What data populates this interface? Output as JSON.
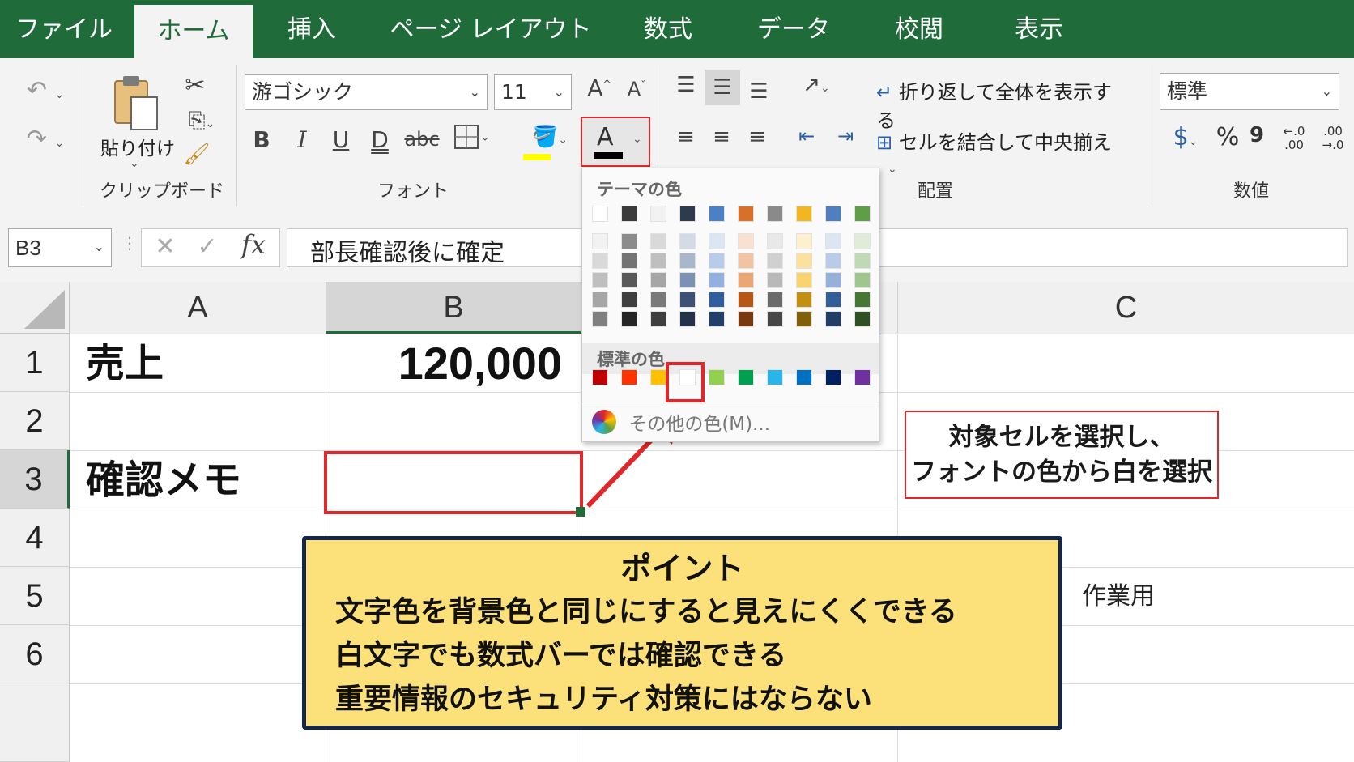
{
  "tabs": [
    "ファイル",
    "ホーム",
    "挿入",
    "ページ レイアウト",
    "数式",
    "データ",
    "校閲",
    "表示"
  ],
  "active_tab": "ホーム",
  "ribbon": {
    "clipboard": {
      "paste_label": "貼り付け",
      "group_label": "クリップボード"
    },
    "font": {
      "name": "游ゴシック",
      "size": "11",
      "group_label": "フォント",
      "bold": "B",
      "italic": "I",
      "underline": "U",
      "double_underline": "D",
      "strike": "abc",
      "grow": "A",
      "shrink": "A",
      "font_color_letter": "A"
    },
    "alignment": {
      "wrap_label": "折り返して全体を表示する",
      "merge_label": "セルを結合して中央揃え",
      "group_label": "配置"
    },
    "number": {
      "format": "標準",
      "group_label": "数値",
      "currency": "$",
      "percent": "%",
      "comma": "9",
      "inc_decimal": "←.0 .00",
      "dec_decimal": ".00 →.0"
    }
  },
  "formula_bar": {
    "name_box": "B3",
    "fx": "fx",
    "content": "部長確認後に確定"
  },
  "columns": [
    "A",
    "B",
    "C"
  ],
  "rows": [
    "1",
    "2",
    "3",
    "4",
    "5",
    "6"
  ],
  "cells": {
    "A1": "売上",
    "B1": "120,000",
    "A3": "確認メモ",
    "C5": "作業用"
  },
  "palette": {
    "theme_label": "テーマの色",
    "standard_label": "標準の色",
    "more_colors": "その他の色(M)...",
    "theme_top": [
      "#ffffff",
      "#3b3b3b",
      "#f2f2f2",
      "#2e3a4f",
      "#4b7fc6",
      "#d8702a",
      "#8a8a8a",
      "#f3b623",
      "#4f7fc0",
      "#5e9e47"
    ],
    "theme_shades": [
      [
        "#f2f2f2",
        "#d9d9d9",
        "#bfbfbf",
        "#a6a6a6",
        "#808080"
      ],
      [
        "#8c8c8c",
        "#737373",
        "#595959",
        "#404040",
        "#262626"
      ],
      [
        "#d9d9d9",
        "#bfbfbf",
        "#a6a6a6",
        "#7a7a7a",
        "#3f3f3f"
      ],
      [
        "#d4dbe6",
        "#a9b7cc",
        "#7d92b3",
        "#3d5276",
        "#24334b"
      ],
      [
        "#dbe5f4",
        "#b7cbea",
        "#93b1df",
        "#2f5f9f",
        "#203f6a"
      ],
      [
        "#f8e1d1",
        "#f1c3a3",
        "#eba676",
        "#b65617",
        "#793a0f"
      ],
      [
        "#e8e8e8",
        "#d0d0d0",
        "#b9b9b9",
        "#6b6b6b",
        "#474747"
      ],
      [
        "#fdf0cf",
        "#fbe19f",
        "#f9d36f",
        "#c28f10",
        "#81600b"
      ],
      [
        "#dce5f2",
        "#b9cbe6",
        "#96b1d9",
        "#325f99",
        "#213f66"
      ],
      [
        "#dfecd9",
        "#bfd9b4",
        "#9fc68e",
        "#467833",
        "#2f5022"
      ]
    ],
    "standard": [
      "#c00000",
      "#ff3300",
      "#ffc000",
      "#ffffff",
      "#92d050",
      "#00a050",
      "#29b5e8",
      "#0070c0",
      "#002060",
      "#7030a0"
    ]
  },
  "note": {
    "line1": "対象セルを選択し、",
    "line2": "フォントの色から白を選択"
  },
  "point": {
    "title": "ポイント",
    "line1": "文字色を背景色と同じにすると見えにくくできる",
    "line2": "白文字でも数式バーでは確認できる",
    "line3": "重要情報のセキュリティ対策にはならない"
  },
  "colors": {
    "excel_green": "#1f6b3a",
    "highlight_red": "#e0282a",
    "point_bg": "#fce17a",
    "point_border": "#14264a",
    "font_color_bar": "#000000",
    "fill_color_bar": "#ffff00"
  }
}
